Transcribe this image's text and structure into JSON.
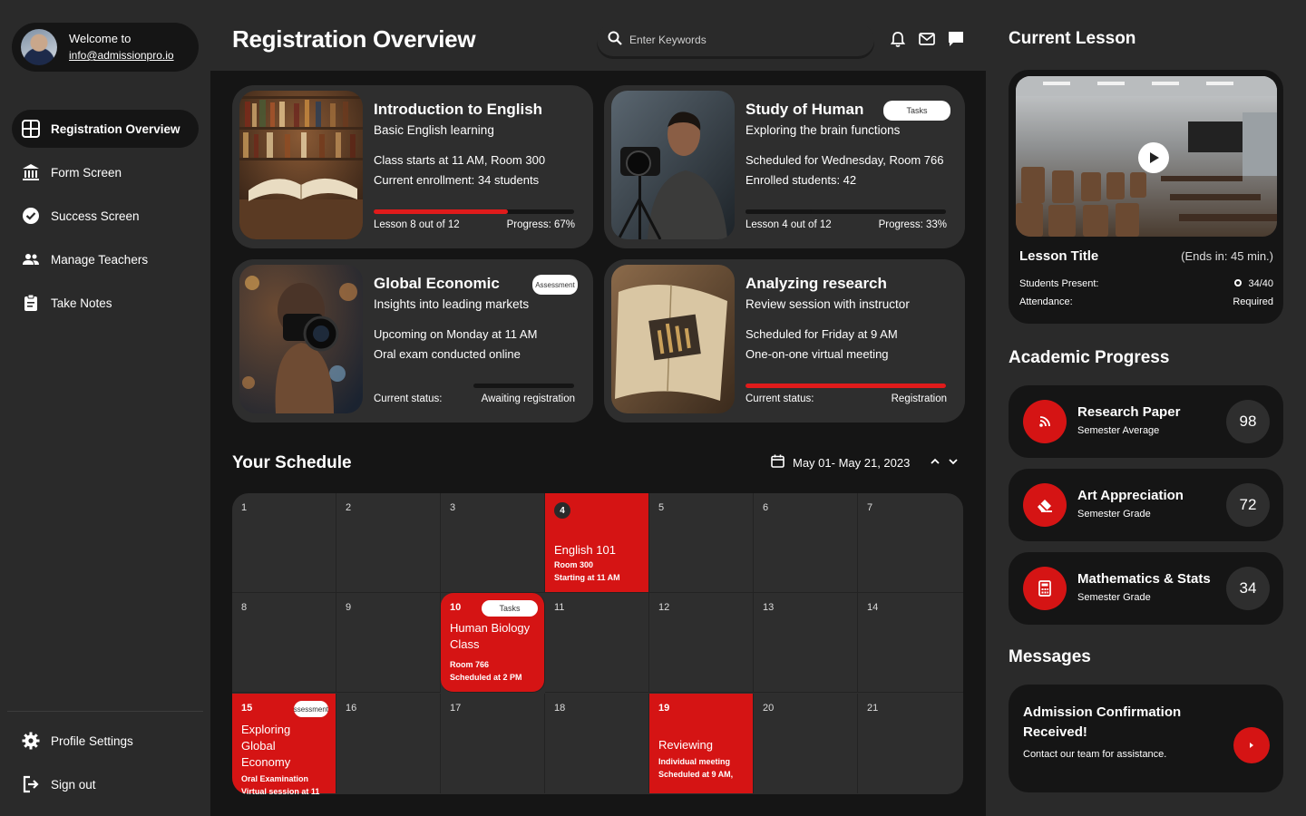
{
  "user": {
    "welcome": "Welcome to",
    "email": "info@admissionpro.io"
  },
  "nav": {
    "items": [
      {
        "label": "Registration Overview",
        "icon": "grid-icon"
      },
      {
        "label": "Form Screen",
        "icon": "bank-icon"
      },
      {
        "label": "Success Screen",
        "icon": "check-circle-icon"
      },
      {
        "label": "Manage Teachers",
        "icon": "people-icon"
      },
      {
        "label": "Take Notes",
        "icon": "clipboard-icon"
      }
    ],
    "bottom": [
      {
        "label": "Profile Settings",
        "icon": "gear-icon"
      },
      {
        "label": "Sign out",
        "icon": "logout-icon"
      }
    ]
  },
  "header": {
    "title": "Registration Overview",
    "search_placeholder": "Enter Keywords"
  },
  "courses": [
    {
      "title": "Introduction to English",
      "subtitle": "Basic English learning",
      "line1": "Class starts at 11 AM, Room 300",
      "line2": "Current enrollment: 34 students",
      "foot_left": "Lesson 8 out of 12",
      "foot_right": "Progress: 67%",
      "progress": 0.67,
      "badge": ""
    },
    {
      "title": "Study of Human",
      "subtitle": "Exploring the brain functions",
      "line1": "Scheduled for Wednesday, Room 766",
      "line2": "Enrolled students: 42",
      "foot_left": "Lesson 4 out of 12",
      "foot_right": "Progress: 33%",
      "progress": 0.33,
      "badge": "Tasks"
    },
    {
      "title": "Global Economic",
      "subtitle": "Insights into leading markets",
      "line1": "Upcoming on Monday at 11 AM",
      "line2": "Oral exam conducted online",
      "foot_left": "Current status:",
      "foot_right": "Awaiting registration",
      "progress": 0,
      "badge": "Assessment"
    },
    {
      "title": "Analyzing research",
      "subtitle": "Review session with instructor",
      "line1": "Scheduled for Friday at 9 AM",
      "line2": "One-on-one virtual meeting",
      "foot_left": "Current status:",
      "foot_right": "Registration",
      "progress": 1.0,
      "badge": ""
    }
  ],
  "schedule": {
    "title": "Your Schedule",
    "range": "May 01- May 21, 2023",
    "days": [
      "1",
      "2",
      "3",
      "4",
      "5",
      "6",
      "7",
      "8",
      "9",
      "10",
      "11",
      "12",
      "13",
      "14",
      "15",
      "16",
      "17",
      "18",
      "19",
      "20",
      "21"
    ],
    "events": {
      "4": {
        "title": "English 101",
        "l1": "Room 300",
        "l2": "Starting at 11 AM",
        "badge": ""
      },
      "10": {
        "title": "Human Biology Class",
        "l1": "Room 766",
        "l2": "Scheduled at 2 PM",
        "badge": "Tasks"
      },
      "15": {
        "title": "Exploring Global Economy",
        "l1": "Oral Examination",
        "l2": "Virtual session at 11",
        "badge": "Assessment"
      },
      "19": {
        "title": "Reviewing",
        "l1": "Individual meeting",
        "l2": "Scheduled at 9 AM,",
        "badge": ""
      }
    }
  },
  "current_lesson": {
    "heading": "Current Lesson",
    "title": "Lesson Title",
    "ends": "(Ends in: 45 min.)",
    "students_label": "Students Present:",
    "students_value": "34/40",
    "attendance_label": "Attendance:",
    "attendance_value": "Required"
  },
  "academic": {
    "heading": "Academic Progress",
    "items": [
      {
        "title": "Research Paper",
        "sub": "Semester Average",
        "score": "98",
        "icon": "rss-icon"
      },
      {
        "title": "Art Appreciation",
        "sub": "Semester Grade",
        "score": "72",
        "icon": "eraser-icon"
      },
      {
        "title": "Mathematics & Stats",
        "sub": "Semester Grade",
        "score": "34",
        "icon": "calculator-icon"
      }
    ]
  },
  "messages": {
    "heading": "Messages",
    "title": "Admission Confirmation Received!",
    "body": "Contact our team for assistance."
  },
  "colors": {
    "accent": "#d51414",
    "panel": "#151515",
    "card": "#2e2e2e"
  }
}
